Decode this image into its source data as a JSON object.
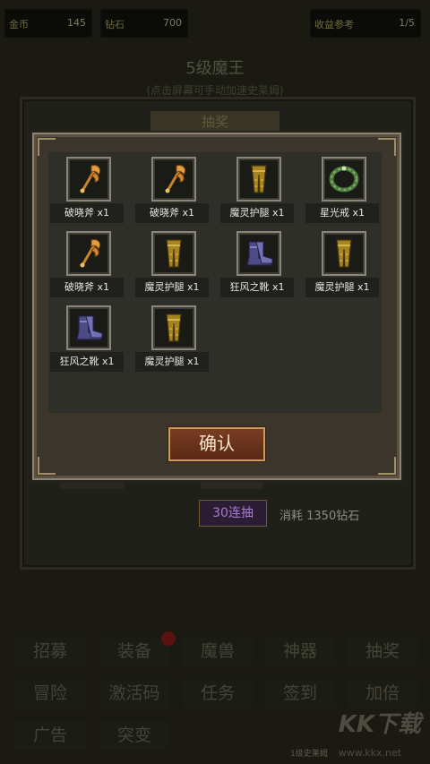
{
  "topbar": {
    "gold_label": "金币",
    "gold_value": "145",
    "diamond_label": "钻石",
    "diamond_value": "700",
    "income_label": "收益参考",
    "page": "1/5"
  },
  "boss": {
    "title": "5级魔王",
    "subtitle": "(点击屏幕可手动加速史莱姆)"
  },
  "bg_panel": {
    "tab_label": "抽奖",
    "btn30_label": "30连抽",
    "cost_text": "消耗 1350钻石"
  },
  "menu": {
    "row1": [
      "招募",
      "装备",
      "魔兽",
      "神器",
      "抽奖"
    ],
    "row2": [
      "冒险",
      "激活码",
      "任务",
      "签到",
      "加倍"
    ],
    "row3": [
      "广告",
      "突变"
    ]
  },
  "footer_note": "1级史莱姆",
  "watermark": {
    "text": "KK下载",
    "url": "www.kkx.net"
  },
  "modal": {
    "items": [
      {
        "name": "破晓斧 x1",
        "icon": "axe-icon"
      },
      {
        "name": "破晓斧 x1",
        "icon": "axe-icon"
      },
      {
        "name": "魔灵护腿 x1",
        "icon": "leggings-icon"
      },
      {
        "name": "星光戒 x1",
        "icon": "ring-icon"
      },
      {
        "name": "破晓斧 x1",
        "icon": "axe-icon"
      },
      {
        "name": "魔灵护腿 x1",
        "icon": "leggings-icon"
      },
      {
        "name": "狂风之靴 x1",
        "icon": "boots-icon"
      },
      {
        "name": "魔灵护腿 x1",
        "icon": "leggings-icon"
      },
      {
        "name": "狂风之靴 x1",
        "icon": "boots-icon"
      },
      {
        "name": "魔灵护腿 x1",
        "icon": "leggings-icon"
      }
    ],
    "confirm_label": "确认"
  },
  "colors": {
    "accent": "#c89c5a",
    "confirm_bg": "#6a3119",
    "purple": "#a87bd0"
  }
}
